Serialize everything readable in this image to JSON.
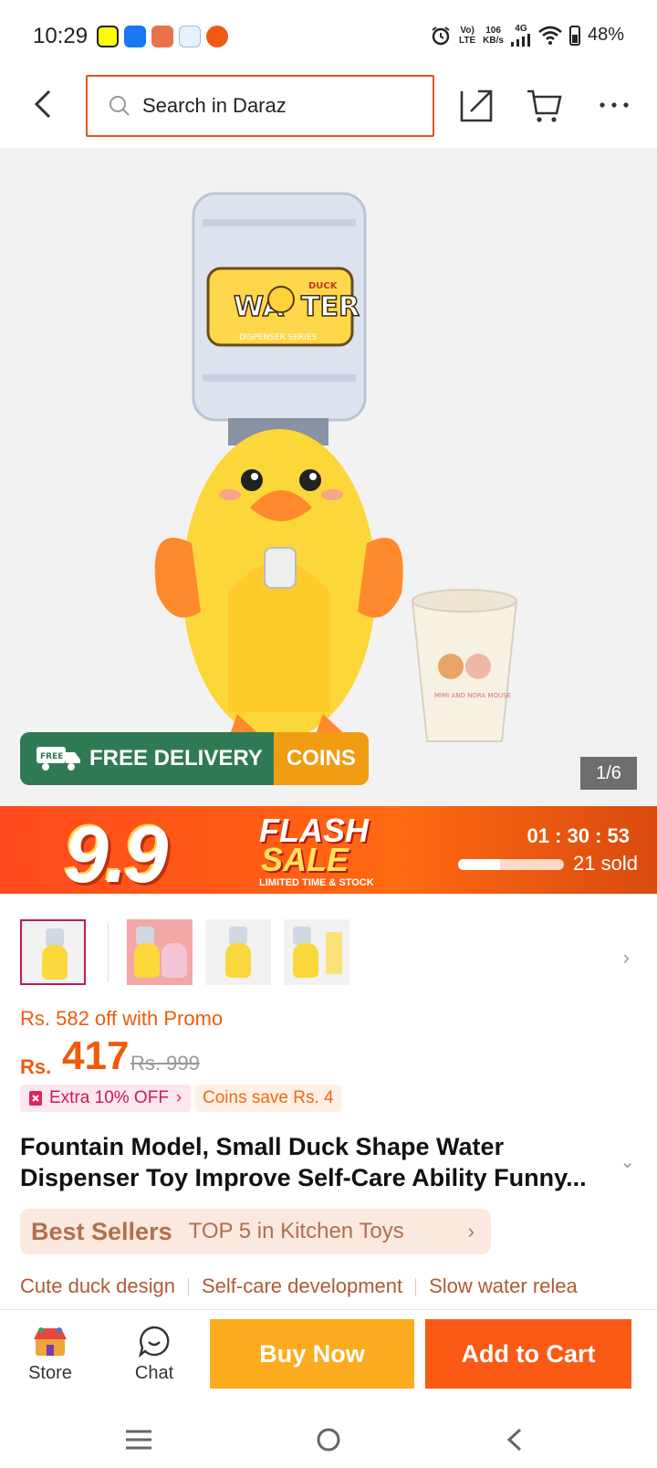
{
  "status_bar": {
    "time": "10:29",
    "volte": "Vo)",
    "lte": "LTE",
    "speed": "106",
    "speed_unit": "KB/s",
    "network": "4G",
    "battery": "48%"
  },
  "header": {
    "search_placeholder": "Search in Daraz"
  },
  "product_image": {
    "counter": "1/6",
    "free_delivery": "FREE DELIVERY",
    "free_tag": "FREE",
    "coins": "COINS",
    "bottle_label_top": "DUCK",
    "bottle_label_main_left": "WA",
    "bottle_label_main_right": "TER",
    "bottle_label_sub": "DISPENSER SERIES",
    "cup_label": "MIMI AND NORA MOUSE"
  },
  "flash_sale": {
    "campaign": "9.9",
    "title_line1": "FLASH",
    "title_line2": "SALE",
    "subtitle": "LIMITED TIME & STOCK",
    "countdown": "01 : 30 : 53",
    "sold": "21 sold",
    "progress": 0.4
  },
  "pricing": {
    "promo": "Rs. 582 off with Promo",
    "currency": "Rs.",
    "price": "417",
    "original_price": "Rs. 999",
    "extra_off": "Extra 10% OFF",
    "coins_save": "Coins save Rs. 4"
  },
  "product": {
    "title": "Fountain Model, Small Duck Shape Water Dispenser Toy Improve Self-Care Ability Funny..."
  },
  "best_sellers": {
    "label": "Best Sellers",
    "rank": "TOP 5 in Kitchen Toys"
  },
  "tags": [
    "Cute duck design",
    "Self-care development",
    "Slow water relea"
  ],
  "bottom_bar": {
    "store": "Store",
    "chat": "Chat",
    "buy_now": "Buy Now",
    "add_to_cart": "Add to Cart"
  },
  "colors": {
    "brand_orange": "#fa5a14",
    "buy_yellow": "#fdac1f",
    "free_green": "#2f7a55"
  }
}
